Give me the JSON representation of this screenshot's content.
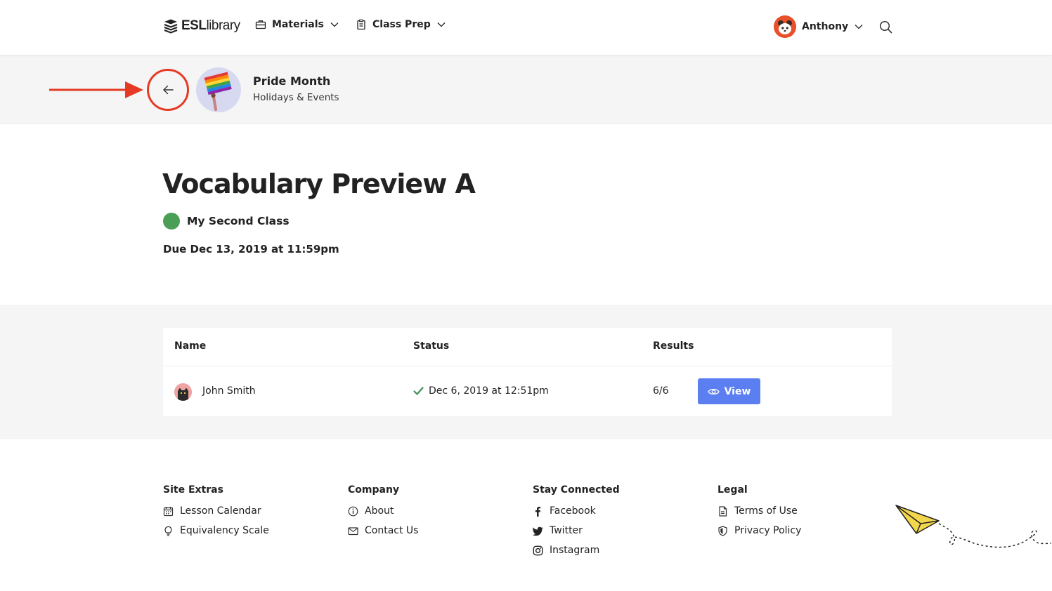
{
  "header": {
    "logo_bold": "ESL",
    "logo_light": "library",
    "nav": [
      {
        "label": "Materials"
      },
      {
        "label": "Class Prep"
      }
    ],
    "user_name": "Anthony"
  },
  "topic": {
    "title": "Pride Month",
    "category": "Holidays & Events"
  },
  "assignment": {
    "title": "Vocabulary Preview A",
    "class_name": "My Second Class",
    "class_color": "#4b9e55",
    "due": "Due Dec 13, 2019 at 11:59pm"
  },
  "table": {
    "columns": [
      "Name",
      "Status",
      "Results"
    ],
    "rows": [
      {
        "name": "John Smith",
        "status": "Dec 6, 2019 at 12:51pm",
        "result": "6/6",
        "action": "View"
      }
    ]
  },
  "footer": {
    "columns": [
      {
        "heading": "Site Extras",
        "links": [
          {
            "label": "Lesson Calendar",
            "icon": "calendar-icon"
          },
          {
            "label": "Equivalency Scale",
            "icon": "lightbulb-icon"
          }
        ]
      },
      {
        "heading": "Company",
        "links": [
          {
            "label": "About",
            "icon": "info-icon"
          },
          {
            "label": "Contact Us",
            "icon": "mail-icon"
          }
        ]
      },
      {
        "heading": "Stay Connected",
        "links": [
          {
            "label": "Facebook",
            "icon": "facebook-icon"
          },
          {
            "label": "Twitter",
            "icon": "twitter-icon"
          },
          {
            "label": "Instagram",
            "icon": "instagram-icon"
          }
        ]
      },
      {
        "heading": "Legal",
        "links": [
          {
            "label": "Terms of Use",
            "icon": "document-icon"
          },
          {
            "label": "Privacy Policy",
            "icon": "shield-icon"
          }
        ]
      }
    ]
  },
  "colors": {
    "accent": "#5b7ff0",
    "annotation": "#e53b25",
    "success": "#3f8f56"
  }
}
